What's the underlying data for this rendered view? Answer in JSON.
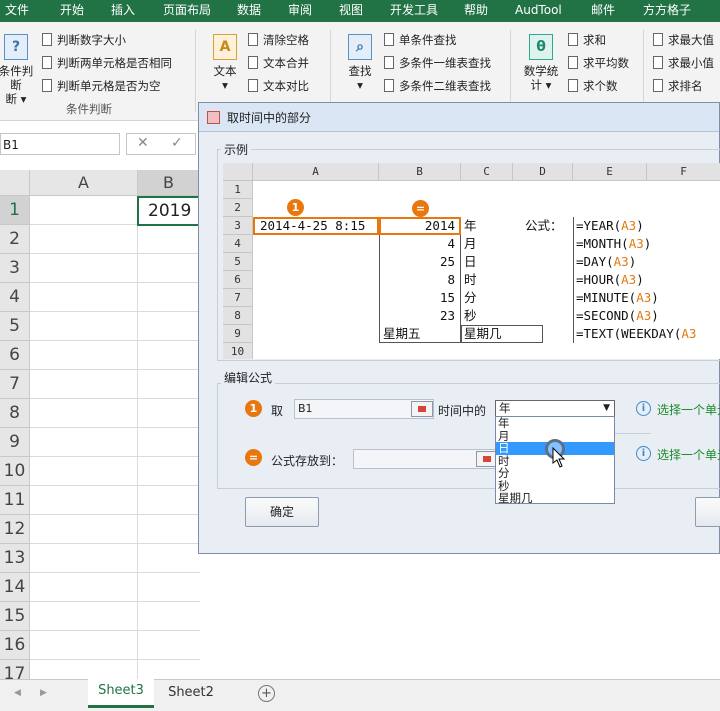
{
  "menubar": {
    "items": [
      "文件",
      "开始",
      "插入",
      "页面布局",
      "数据",
      "审阅",
      "视图",
      "开发工具",
      "帮助",
      "AudTool",
      "邮件",
      "方方格子"
    ]
  },
  "ribbon": {
    "cond_big": {
      "label": "条件判断",
      "sub": "断 ▾"
    },
    "cond_items": [
      "判断数字大小",
      "判断两单元格是否相同",
      "判断单元格是否为空"
    ],
    "group_label": "条件判断",
    "text_big": "文本",
    "text_items": [
      "清除空格",
      "文本合并",
      "文本对比"
    ],
    "find_big": "查找",
    "find_items": [
      "单条件查找",
      "多条件一维表查找",
      "多条件二维表查找"
    ],
    "stat_big": {
      "label": "数学统",
      "sub": "计 ▾"
    },
    "stat_items": [
      "求和",
      "求平均数",
      "求个数"
    ],
    "max_items": [
      "求最大值",
      "求最小值",
      "求排名"
    ]
  },
  "formula_bar": {
    "name_box": "B1",
    "cancel_icon": "✕",
    "enter_icon": "✓"
  },
  "sheet": {
    "col_headers": [
      "A",
      "B"
    ],
    "rows": [
      "1",
      "2",
      "3",
      "4",
      "5",
      "6",
      "7",
      "8",
      "9",
      "10",
      "11",
      "12",
      "13",
      "14",
      "15",
      "16",
      "17"
    ],
    "b1_value": "2019"
  },
  "tabs": {
    "prev": "◀",
    "next": "▶",
    "active": "Sheet3",
    "other": "Sheet2",
    "add": "+"
  },
  "dialog": {
    "title": "取时间中的部分",
    "example_label": "示例",
    "mini_cols": [
      "A",
      "B",
      "C",
      "D",
      "E",
      "F"
    ],
    "mini_rows": [
      "1",
      "2",
      "3",
      "4",
      "5",
      "6",
      "7",
      "8",
      "9",
      "10"
    ],
    "marker1": "1",
    "marker_eq": "=",
    "a3": "2014-4-25 8:15",
    "b_values": [
      "2014",
      "4",
      "25",
      "8",
      "15",
      "23",
      "星期五"
    ],
    "c_values": [
      "年",
      "月",
      "日",
      "时",
      "分",
      "秒",
      "星期几"
    ],
    "d3": "公式：",
    "formulas": [
      {
        "pre": "=YEAR(",
        "ref": "A3",
        "post": ")"
      },
      {
        "pre": "=MONTH(",
        "ref": "A3",
        "post": ")"
      },
      {
        "pre": "=DAY(",
        "ref": "A3",
        "post": ")"
      },
      {
        "pre": "=HOUR(",
        "ref": "A3",
        "post": ")"
      },
      {
        "pre": "=MINUTE(",
        "ref": "A3",
        "post": ")"
      },
      {
        "pre": "=SECOND(",
        "ref": "A3",
        "post": ")"
      },
      {
        "pre": "=TEXT(WEEKDAY(",
        "ref": "A3",
        "post": ""
      }
    ],
    "edit_label": "编辑公式",
    "step1_marker": "1",
    "take_label": "取",
    "cell_ref_value": "B1",
    "time_part_label": "时间中的",
    "select_value": "年",
    "options": [
      "年",
      "月",
      "日",
      "时",
      "分",
      "秒",
      "星期几"
    ],
    "hint1": "选择一个单元",
    "step2_marker": "=",
    "store_label": "公式存放到：",
    "store_value": "",
    "hint2": "选择一个单元",
    "ok_label": "确定"
  },
  "colors": {
    "excel_green": "#217346",
    "orange": "#e8770e",
    "highlight": "#3399ff",
    "hint_green": "#1d8a2a"
  }
}
